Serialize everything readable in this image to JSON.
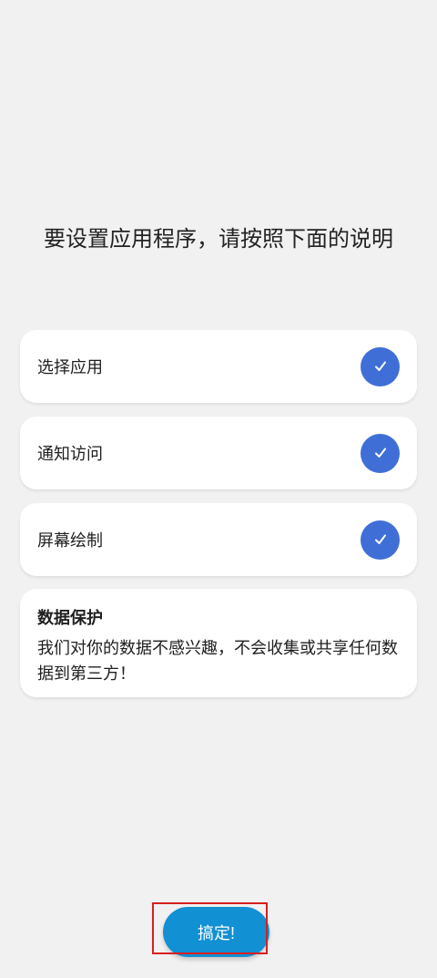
{
  "header": {
    "title": "要设置应用程序，请按照下面的说明"
  },
  "steps": [
    {
      "label": "选择应用",
      "completed": true,
      "icon": "check-icon"
    },
    {
      "label": "通知访问",
      "completed": true,
      "icon": "check-icon"
    },
    {
      "label": "屏幕绘制",
      "completed": true,
      "icon": "check-icon"
    }
  ],
  "privacy": {
    "title": "数据保护",
    "body": "我们对你的数据不感兴趣，不会收集或共享任何数据到第三方！"
  },
  "actions": {
    "done_label": "搞定!"
  },
  "colors": {
    "background": "#f1f1f1",
    "card": "#ffffff",
    "check_circle": "#3f6fd6",
    "primary_button": "#1190d3",
    "highlight": "#d81f1f"
  }
}
